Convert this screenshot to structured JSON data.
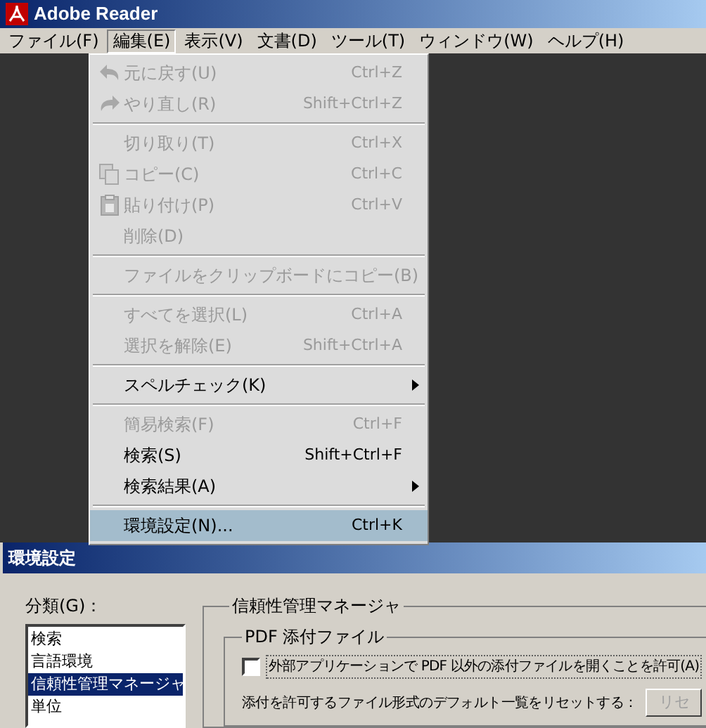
{
  "window": {
    "title": "Adobe Reader"
  },
  "menubar": [
    {
      "label": "ファイル(F)",
      "selected": false
    },
    {
      "label": "編集(E)",
      "selected": true
    },
    {
      "label": "表示(V)",
      "selected": false
    },
    {
      "label": "文書(D)",
      "selected": false
    },
    {
      "label": "ツール(T)",
      "selected": false
    },
    {
      "label": "ウィンドウ(W)",
      "selected": false
    },
    {
      "label": "ヘルプ(H)",
      "selected": false
    }
  ],
  "edit_menu": [
    {
      "kind": "item",
      "label": "元に戻す(U)",
      "shortcut": "Ctrl+Z",
      "disabled": true,
      "submenu": false,
      "selected": false
    },
    {
      "kind": "item",
      "label": "やり直し(R)",
      "shortcut": "Shift+Ctrl+Z",
      "disabled": true,
      "submenu": false,
      "selected": false
    },
    {
      "kind": "separator"
    },
    {
      "kind": "item",
      "label": "切り取り(T)",
      "shortcut": "Ctrl+X",
      "disabled": true,
      "submenu": false,
      "selected": false
    },
    {
      "kind": "item",
      "label": "コピー(C)",
      "shortcut": "Ctrl+C",
      "disabled": true,
      "submenu": false,
      "selected": false
    },
    {
      "kind": "item",
      "label": "貼り付け(P)",
      "shortcut": "Ctrl+V",
      "disabled": true,
      "submenu": false,
      "selected": false
    },
    {
      "kind": "item",
      "label": "削除(D)",
      "disabled": true,
      "submenu": false,
      "selected": false
    },
    {
      "kind": "separator"
    },
    {
      "kind": "item",
      "label": "ファイルをクリップボードにコピー(B)",
      "disabled": true,
      "submenu": false,
      "selected": false
    },
    {
      "kind": "separator"
    },
    {
      "kind": "item",
      "label": "すべてを選択(L)",
      "shortcut": "Ctrl+A",
      "disabled": true,
      "submenu": false,
      "selected": false
    },
    {
      "kind": "item",
      "label": "選択を解除(E)",
      "shortcut": "Shift+Ctrl+A",
      "disabled": true,
      "submenu": false,
      "selected": false
    },
    {
      "kind": "separator"
    },
    {
      "kind": "item",
      "label": "スペルチェック(K)",
      "disabled": false,
      "submenu": true,
      "selected": false
    },
    {
      "kind": "separator"
    },
    {
      "kind": "item",
      "label": "簡易検索(F)",
      "shortcut": "Ctrl+F",
      "disabled": true,
      "submenu": false,
      "selected": false
    },
    {
      "kind": "item",
      "label": "検索(S)",
      "shortcut": "Shift+Ctrl+F",
      "disabled": false,
      "submenu": false,
      "selected": false
    },
    {
      "kind": "item",
      "label": "検索結果(A)",
      "disabled": false,
      "submenu": true,
      "selected": false
    },
    {
      "kind": "separator"
    },
    {
      "kind": "item",
      "label": "環境設定(N)...",
      "shortcut": "Ctrl+K",
      "disabled": false,
      "submenu": false,
      "selected": true
    }
  ],
  "dialog": {
    "title": "環境設定",
    "category_label": "分類(G)：",
    "categories": [
      {
        "label": "検索",
        "selected": false
      },
      {
        "label": "言語環境",
        "selected": false
      },
      {
        "label": "信頼性管理マネージャ",
        "selected": true
      },
      {
        "label": "単位",
        "selected": false
      }
    ],
    "group_title": "信頼性管理マネージャ",
    "subgroup_title": "PDF 添付ファイル",
    "checkbox": {
      "label": "外部アプリケーションで PDF 以外の添付ファイルを開くことを許可(A)",
      "checked": false
    },
    "reset_label": "添付を許可するファイル形式のデフォルト一覧をリセットする：",
    "reset_button": "リセ"
  }
}
